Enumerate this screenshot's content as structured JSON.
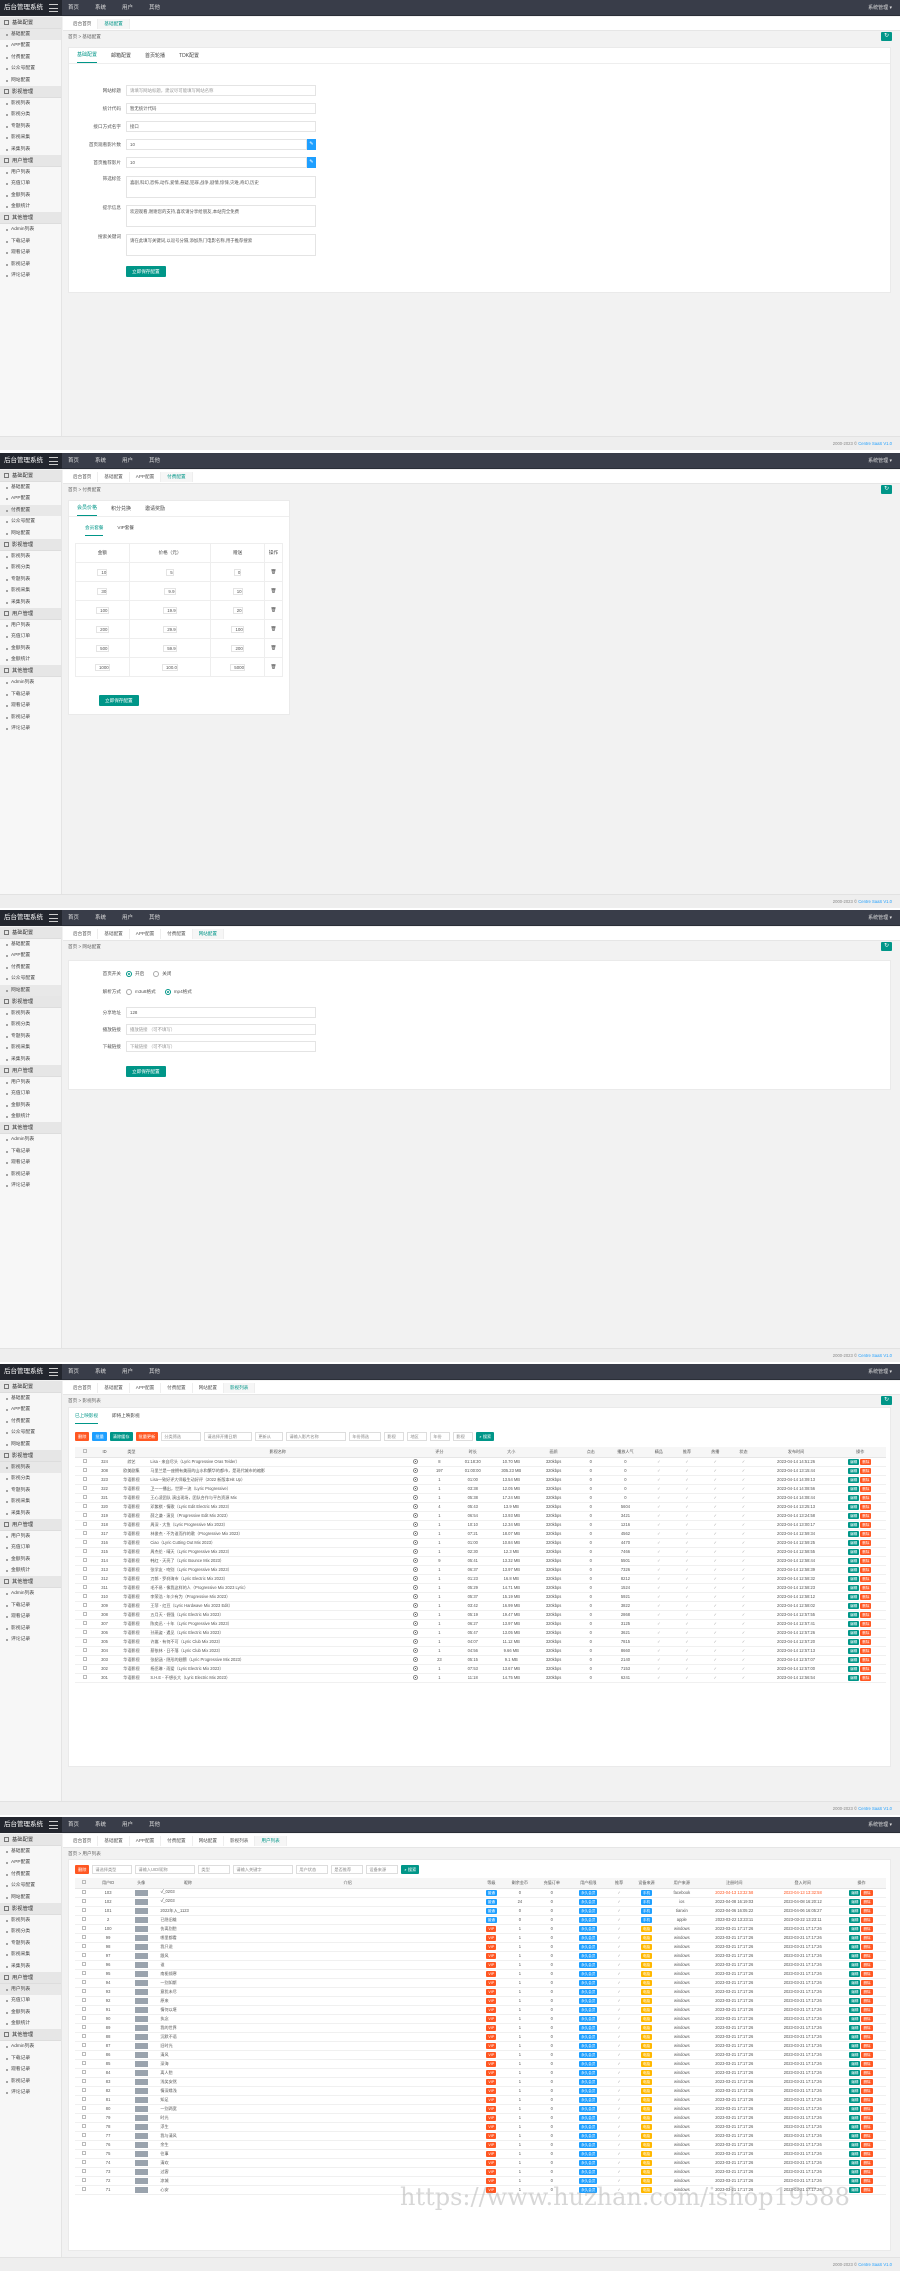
{
  "app": {
    "brand": "后台管理系统",
    "user": "系统管理 ▾"
  },
  "topnav": [
    "首页",
    "系统",
    "用户",
    "其他"
  ],
  "footer": {
    "copy": "2000-2023 © ",
    "link": "Centre SaaS V1.0"
  },
  "sidebar": {
    "groups": [
      {
        "title": "基础配置",
        "items": [
          "基础配置",
          "APP配置",
          "付费配置",
          "公众号配置",
          "网站配置"
        ]
      },
      {
        "title": "影视管理",
        "items": [
          "影视列表",
          "影视分类",
          "专题列表",
          "影视采集",
          "采集列表"
        ]
      },
      {
        "title": "用户管理",
        "items": [
          "用户列表",
          "充值订单",
          "金额列表",
          "金额统计"
        ]
      },
      {
        "title": "其他管理",
        "items": [
          "Admin列表",
          "下载记录",
          "观看记录",
          "影视记录",
          "评论记录"
        ]
      }
    ]
  },
  "shot1": {
    "tabs": [
      "后台首页",
      "基础配置"
    ],
    "crumb": "首页 > 基础配置",
    "form_tabs": [
      "基础配置",
      "邮箱配置",
      "首页轮播",
      "TDK配置"
    ],
    "fields": [
      {
        "label": "网站标题",
        "value": "请填写网站标题，建议尽可能填写网站名称"
      },
      {
        "label": "统计代码",
        "value": "暂无统计代码"
      },
      {
        "label": "接口方式名字",
        "value": "接口"
      },
      {
        "label": "首页观看影片数",
        "value": "10"
      },
      {
        "label": "首页推荐影片",
        "value": "10"
      }
    ],
    "textareas": [
      {
        "label": "筛选标签",
        "value": "喜剧,科幻,恐怖,动作,爱情,悬疑,犯罪,战争,剧情,惊悚,灾难,奇幻,历史"
      },
      {
        "label": "提示信息",
        "value": "欢迎观看,谢谢您的支持,喜欢请分享给朋友,本站完全免费"
      },
      {
        "label": "搜索关键词",
        "value": "请在此填写关键词,以逗号分隔,添加热门电影名称,用于推荐搜索"
      }
    ],
    "submit": "立即保存配置"
  },
  "shot2": {
    "tabs": [
      "后台首页",
      "基础配置",
      "APP配置",
      "付费配置"
    ],
    "crumb": "首页 > 付费配置",
    "form_tabs": [
      "会员价格",
      "积分兑换",
      "邀请奖励"
    ],
    "sub_tabs": [
      "会员套餐",
      "VIP套餐"
    ],
    "headers": [
      "金额",
      "价格（元）",
      "赠送",
      "操作"
    ],
    "rows": [
      [
        "10",
        "5",
        "0"
      ],
      [
        "30",
        "9.9",
        "10"
      ],
      [
        "100",
        "19.9",
        "20"
      ],
      [
        "200",
        "29.9",
        "100"
      ],
      [
        "500",
        "59.9",
        "200"
      ],
      [
        "1000",
        "100.0",
        "5000"
      ]
    ],
    "submit": "立即保存配置"
  },
  "shot3": {
    "tabs": [
      "后台首页",
      "基础配置",
      "APP配置",
      "付费配置",
      "网站配置"
    ],
    "crumb": "首页 > 网站配置",
    "radio1_label": "首页开关",
    "radio1": [
      "开启",
      "关闭"
    ],
    "radio2_label": "解析方式",
    "radio2": [
      "m3u8格式",
      "mp4格式"
    ],
    "fields": [
      {
        "label": "分享地址",
        "value": "128"
      },
      {
        "label": "播放链接",
        "value": "播放链接  （可不填写）"
      },
      {
        "label": "下载链接",
        "value": "下载链接  （可不填写）"
      }
    ],
    "submit": "立即保存配置"
  },
  "shot4": {
    "tabs": [
      "后台首页",
      "基础配置",
      "APP配置",
      "付费配置",
      "网站配置",
      "影视列表"
    ],
    "crumb": "首页 > 影视列表",
    "list_tabs": [
      "已上映影视",
      "即将上映影视"
    ],
    "buttons": [
      "删除",
      "批量",
      "清除缓存",
      "批量更新"
    ],
    "filters": [
      "分类筛选",
      "请选择开播日期",
      "更新从",
      "请输入影片名称",
      "年份筛选",
      "影视",
      "地区",
      "年份",
      "影视"
    ],
    "search": "搜索",
    "headers": [
      "ID",
      "类型",
      "影视名称",
      "",
      "评分",
      "时长",
      "大小",
      "画质",
      "点击",
      "播放人气",
      "精品",
      "推荐",
      "热播",
      "状态",
      "发布时间",
      "操作"
    ],
    "rows": [
      [
        "324",
        "综艺",
        "Lisa - 来自尽头（Lyric Progressive Oras Telder）",
        "8",
        "01:18:30",
        "10.70 MB",
        "320kbps",
        "0",
        "0",
        "2023-04-14 14:51:26"
      ],
      [
        "308",
        "欧美剧集",
        "马里兰是一座拥有美丽的山水和繁华的都市，是现代城市的缩影",
        "197",
        "01:00:00",
        "305.23 MB",
        "320kbps",
        "0",
        "0",
        "2023-04-14 13:15:44"
      ],
      [
        "323",
        "华语影视",
        "Lisa一致好评大师级生动好评（2022 新版本Hit Up）",
        "1",
        "01:00",
        "13.54 MB",
        "320kbps",
        "0",
        "0",
        "2023-04-14 14:09:13"
      ],
      [
        "322",
        "华语影视",
        "卫一一播出，世界一流（Lyric Progressive）",
        "1",
        "03:38",
        "12.05 MB",
        "320kbps",
        "0",
        "0",
        "2023-04-14 14:08:56"
      ],
      [
        "321",
        "华语影视",
        "王心凌团队 演出现场，团队合作与平台资源 Mix",
        "1",
        "05:38",
        "17.24 MB",
        "320kbps",
        "0",
        "0",
        "2023-04-14 14:08:44"
      ],
      [
        "320",
        "华语影视",
        "邓紫棋 - 情歌（Lyric Edit Electric Mix 2023）",
        "4",
        "05:43",
        "13.9 MB",
        "320kbps",
        "0",
        "5604",
        "2023-04-14 13:25:13"
      ],
      [
        "319",
        "华语影视",
        "薛之谦 - 演员（Progressive Edit Mix 2023）",
        "1",
        "06:54",
        "13.93 MB",
        "320kbps",
        "0",
        "3421",
        "2023-04-14 13:24:58"
      ],
      [
        "318",
        "华语影视",
        "周深 - 大鱼（Lyric Progressive Mix 2023）",
        "1",
        "10:10",
        "12.34 MB",
        "320kbps",
        "0",
        "1216",
        "2023-04-14 13:00:17"
      ],
      [
        "317",
        "华语影视",
        "林俊杰 - 不为谁而作的歌（Progressive Mix 2023）",
        "1",
        "07:21",
        "18.07 MB",
        "320kbps",
        "0",
        "4562",
        "2023-04-14 12:59:34"
      ],
      [
        "316",
        "华语影视",
        "Ciao（Lyric Cutting Out Mix 2023）",
        "1",
        "01:00",
        "10.84 MB",
        "320kbps",
        "0",
        "4470",
        "2023-04-14 12:59:25"
      ],
      [
        "315",
        "华语影视",
        "周杰伦 - 晴天（Lyric Progressive Mix 2023）",
        "1",
        "02:30",
        "12.3 MB",
        "320kbps",
        "0",
        "7466",
        "2023-04-14 12:58:55"
      ],
      [
        "314",
        "华语影视",
        "韩红 - 天亮了（Lyric Bounce Mix 2023）",
        "9",
        "05:41",
        "13.32 MB",
        "320kbps",
        "0",
        "5501",
        "2023-04-14 12:58:44"
      ],
      [
        "313",
        "华语影视",
        "张学友 - 吻别（Lyric Progressive Mix 2023）",
        "1",
        "06:37",
        "13.97 MB",
        "320kbps",
        "0",
        "7326",
        "2023-04-14 12:58:39"
      ],
      [
        "312",
        "华语影视",
        "刀郎 - 罗刹海市（Lyric Electric Mix 2023）",
        "1",
        "01:23",
        "16.8 MB",
        "320kbps",
        "0",
        "8212",
        "2023-04-14 12:58:32"
      ],
      [
        "311",
        "华语影视",
        "毛不易 - 像我这样的人（Progressive Mix 2023 Lyric）",
        "1",
        "05:29",
        "14.71 MB",
        "320kbps",
        "0",
        "1524",
        "2023-04-14 12:58:23"
      ],
      [
        "310",
        "华语影视",
        "李荣浩 - 年少有为（Progressive Mix 2023）",
        "1",
        "05:37",
        "15.19 MB",
        "320kbps",
        "0",
        "5921",
        "2023-04-14 12:58:12"
      ],
      [
        "309",
        "华语影视",
        "王菲 - 红豆（Lyric Hardwave Mix 2023 Edit）",
        "1",
        "03:42",
        "16.99 MB",
        "320kbps",
        "0",
        "3822",
        "2023-04-14 12:58:02"
      ],
      [
        "308",
        "华语影视",
        "五月天 - 倔强（Lyric Electric Mix 2023）",
        "1",
        "05:19",
        "19.47 MB",
        "320kbps",
        "0",
        "2868",
        "2023-04-14 12:57:55"
      ],
      [
        "307",
        "华语影视",
        "陈奕迅 - 十年（Lyric Progressive Mix 2023）",
        "1",
        "06:27",
        "13.97 MB",
        "320kbps",
        "0",
        "3125",
        "2023-04-14 12:57:41"
      ],
      [
        "306",
        "华语影视",
        "孙燕姿 - 遇见（Lyric Electric Mix 2023）",
        "1",
        "05:47",
        "13.05 MB",
        "320kbps",
        "0",
        "3621",
        "2023-04-14 12:57:26"
      ],
      [
        "305",
        "华语影视",
        "许嵩 - 有何不可（Lyric Club Mix 2023）",
        "1",
        "04:07",
        "11.12 MB",
        "320kbps",
        "0",
        "7815",
        "2023-04-14 12:57:20"
      ],
      [
        "304",
        "华语影视",
        "蔡依林 - 日不落（Lyric Club Mix 2023）",
        "1",
        "04:56",
        "9.66 MB",
        "320kbps",
        "0",
        "8660",
        "2023-04-14 12:57:13"
      ],
      [
        "303",
        "华语影视",
        "张韶涵 - 隐形的翅膀（Lyric Progressive Mix 2023）",
        "23",
        "05:15",
        "9.1 MB",
        "320kbps",
        "0",
        "2140",
        "2023-04-14 12:57:07"
      ],
      [
        "302",
        "华语影视",
        "杨丞琳 - 雨爱（Lyric Electric Mix 2023）",
        "1",
        "07:53",
        "13.67 MB",
        "320kbps",
        "0",
        "7153",
        "2023-04-14 12:57:00"
      ],
      [
        "301",
        "华语影视",
        "S.H.E - 不想长大（Lyric Electric Mix 2023）",
        "1",
        "11:18",
        "14.75 MB",
        "320kbps",
        "0",
        "6241",
        "2023-04-14 12:56:54"
      ]
    ],
    "op_edit": "编辑",
    "op_del": "删除"
  },
  "shot5": {
    "tabs": [
      "后台首页",
      "基础配置",
      "APP配置",
      "付费配置",
      "网站配置",
      "影视列表",
      "用户列表"
    ],
    "crumb": "首页 > 用户列表",
    "buttons": [
      "删除"
    ],
    "filters": [
      "请选择类型",
      "请输入UID/昵称",
      "类型",
      "请输入关键字",
      "用户状态",
      "是否推荐",
      "设备来源"
    ],
    "search": "搜索",
    "headers": [
      "用户ID",
      "头像",
      "昵称",
      "介绍",
      "等级",
      "剩余金币",
      "充值订单",
      "用户权限",
      "推荐",
      "设备来源",
      "用户来源",
      "注册时间",
      "登入时间",
      "操作"
    ],
    "rows": [
      [
        "103",
        "ꪜ_0203",
        "普通",
        "0",
        "0",
        "永久会员",
        "手机",
        "facebook",
        "2023-04-13 13:32:58",
        "2023-04-13 13:32:58",
        "r"
      ],
      [
        "102",
        "ꪜ_0203",
        "普通",
        "24",
        "0",
        "永久会员",
        "手机",
        "ios",
        "2023-04-08 16:19:03",
        "2023-04-08 16:20:12",
        ""
      ],
      [
        "101",
        "2022年入_1123",
        "普通",
        "0",
        "0",
        "永久会员",
        "手机",
        "tianxin",
        "2023-04-06 16:05:22",
        "2023-04-06 16:05:27",
        ""
      ],
      [
        "2",
        "已隐旧雄",
        "普通",
        "0",
        "0",
        "永久会员",
        "手机",
        "apple",
        "2023-03-22 13:23:11",
        "2023-03-22 13:23:11",
        ""
      ],
      [
        "100",
        "伤离别愁",
        "VIP",
        "1",
        "0",
        "永久会员",
        "电脑",
        "windows",
        "2023-03-21 17:17:26",
        "2023-03-21 17:17:26",
        ""
      ],
      [
        "99",
        "哪里都看",
        "VIP",
        "1",
        "0",
        "永久会员",
        "电脑",
        "windows",
        "2023-03-21 17:17:26",
        "2023-03-21 17:17:26",
        ""
      ],
      [
        "98",
        "我只说",
        "VIP",
        "1",
        "0",
        "永久会员",
        "电脑",
        "windows",
        "2023-03-21 17:17:26",
        "2023-03-21 17:17:26",
        ""
      ],
      [
        "97",
        "跟风",
        "VIP",
        "1",
        "0",
        "永久会员",
        "电脑",
        "windows",
        "2023-03-21 17:17:26",
        "2023-03-21 17:17:26",
        ""
      ],
      [
        "96",
        "谁",
        "VIP",
        "1",
        "0",
        "永久会员",
        "电脑",
        "windows",
        "2023-03-21 17:17:26",
        "2023-03-21 17:17:26",
        ""
      ],
      [
        "95",
        "南栀倾寒",
        "VIP",
        "1",
        "0",
        "永久会员",
        "电脑",
        "windows",
        "2023-03-21 17:17:26",
        "2023-03-21 17:17:26",
        ""
      ],
      [
        "94",
        "一别如斯",
        "VIP",
        "1",
        "0",
        "永久会员",
        "电脑",
        "windows",
        "2023-03-21 17:17:26",
        "2023-03-21 17:17:26",
        ""
      ],
      [
        "93",
        "意犹未尽",
        "VIP",
        "1",
        "0",
        "永久会员",
        "电脑",
        "windows",
        "2023-03-21 17:17:26",
        "2023-03-21 17:17:26",
        ""
      ],
      [
        "92",
        "原来",
        "VIP",
        "1",
        "0",
        "永久会员",
        "电脑",
        "windows",
        "2023-03-21 17:17:26",
        "2023-03-21 17:17:26",
        ""
      ],
      [
        "91",
        "情何以堪",
        "VIP",
        "1",
        "0",
        "永久会员",
        "电脑",
        "windows",
        "2023-03-21 17:17:26",
        "2023-03-21 17:17:26",
        ""
      ],
      [
        "90",
        "执念",
        "VIP",
        "1",
        "0",
        "永久会员",
        "电脑",
        "windows",
        "2023-03-21 17:17:26",
        "2023-03-21 17:17:26",
        ""
      ],
      [
        "89",
        "我的世界",
        "VIP",
        "1",
        "0",
        "永久会员",
        "电脑",
        "windows",
        "2023-03-21 17:17:26",
        "2023-03-21 17:17:26",
        ""
      ],
      [
        "88",
        "沉默不语",
        "VIP",
        "1",
        "0",
        "永久会员",
        "电脑",
        "windows",
        "2023-03-21 17:17:26",
        "2023-03-21 17:17:26",
        ""
      ],
      [
        "87",
        "旧时光",
        "VIP",
        "1",
        "0",
        "永久会员",
        "电脑",
        "windows",
        "2023-03-21 17:17:26",
        "2023-03-21 17:17:26",
        ""
      ],
      [
        "86",
        "清风",
        "VIP",
        "1",
        "0",
        "永久会员",
        "电脑",
        "windows",
        "2023-03-21 17:17:26",
        "2023-03-21 17:17:26",
        ""
      ],
      [
        "85",
        "深海",
        "VIP",
        "1",
        "0",
        "永久会员",
        "电脑",
        "windows",
        "2023-03-21 17:17:26",
        "2023-03-21 17:17:26",
        ""
      ],
      [
        "84",
        "离人愁",
        "VIP",
        "1",
        "0",
        "永久会员",
        "电脑",
        "windows",
        "2023-03-21 17:17:26",
        "2023-03-21 17:17:26",
        ""
      ],
      [
        "83",
        "浅笑安然",
        "VIP",
        "1",
        "0",
        "永久会员",
        "电脑",
        "windows",
        "2023-03-21 17:17:26",
        "2023-03-21 17:17:26",
        ""
      ],
      [
        "82",
        "情深缘浅",
        "VIP",
        "1",
        "0",
        "永久会员",
        "电脑",
        "windows",
        "2023-03-21 17:17:26",
        "2023-03-21 17:17:26",
        ""
      ],
      [
        "81",
        "知足",
        "VIP",
        "1",
        "0",
        "永久会员",
        "电脑",
        "windows",
        "2023-03-21 17:17:26",
        "2023-03-21 17:17:26",
        ""
      ],
      [
        "80",
        "一别两宽",
        "VIP",
        "1",
        "0",
        "永久会员",
        "电脑",
        "windows",
        "2023-03-21 17:17:26",
        "2023-03-21 17:17:26",
        ""
      ],
      [
        "79",
        "时光",
        "VIP",
        "1",
        "0",
        "永久会员",
        "电脑",
        "windows",
        "2023-03-21 17:17:26",
        "2023-03-21 17:17:26",
        ""
      ],
      [
        "78",
        "浮生",
        "VIP",
        "1",
        "0",
        "永久会员",
        "电脑",
        "windows",
        "2023-03-21 17:17:26",
        "2023-03-21 17:17:26",
        ""
      ],
      [
        "77",
        "我与清风",
        "VIP",
        "1",
        "0",
        "永久会员",
        "电脑",
        "windows",
        "2023-03-21 17:17:26",
        "2023-03-21 17:17:26",
        ""
      ],
      [
        "76",
        "余生",
        "VIP",
        "1",
        "0",
        "永久会员",
        "电脑",
        "windows",
        "2023-03-21 17:17:26",
        "2023-03-21 17:17:26",
        ""
      ],
      [
        "75",
        "往事",
        "VIP",
        "1",
        "0",
        "永久会员",
        "电脑",
        "windows",
        "2023-03-21 17:17:26",
        "2023-03-21 17:17:26",
        ""
      ],
      [
        "74",
        "清欢",
        "VIP",
        "1",
        "0",
        "永久会员",
        "电脑",
        "windows",
        "2023-03-21 17:17:26",
        "2023-03-21 17:17:26",
        ""
      ],
      [
        "73",
        "过客",
        "VIP",
        "1",
        "0",
        "永久会员",
        "电脑",
        "windows",
        "2023-03-21 17:17:26",
        "2023-03-21 17:17:26",
        ""
      ],
      [
        "72",
        "凉城",
        "VIP",
        "1",
        "0",
        "永久会员",
        "电脑",
        "windows",
        "2023-03-21 17:17:26",
        "2023-03-21 17:17:26",
        ""
      ],
      [
        "71",
        "心安",
        "VIP",
        "1",
        "0",
        "永久会员",
        "电脑",
        "windows",
        "2023-03-21 17:17:26",
        "2023-03-21 17:17:26",
        ""
      ]
    ],
    "op_edit": "编辑",
    "op_del": "删除"
  },
  "watermark": "https://www.huzhan.com/ishop19588",
  "colors": {
    "teal": "#009688",
    "blue": "#1e9fff",
    "orange": "#ff5722",
    "yellow": "#ffb800",
    "dark": "#393d49"
  }
}
